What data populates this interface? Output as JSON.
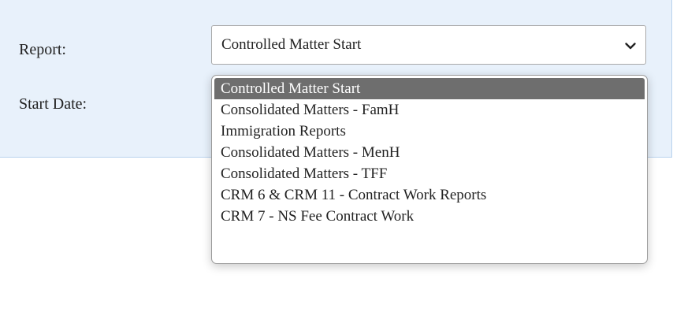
{
  "form": {
    "report_label": "Report:",
    "start_date_label": "Start Date:"
  },
  "report_select": {
    "selected_value": "Controlled Matter Start",
    "options": [
      "Controlled Matter Start",
      "Consolidated Matters - FamH",
      "Immigration Reports",
      "Consolidated Matters - MenH",
      "Consolidated Matters - TFF",
      "CRM 6 & CRM 11 - Contract Work Reports",
      "CRM 7 - NS Fee Contract Work"
    ],
    "selected_index": 0,
    "dropdown_open": true
  },
  "colors": {
    "panel_background": "#e8f1fb",
    "panel_border": "#b9d3ee",
    "option_highlight": "#6e6e6e"
  },
  "icons": {
    "select_indicator": "chevron-down-icon"
  }
}
